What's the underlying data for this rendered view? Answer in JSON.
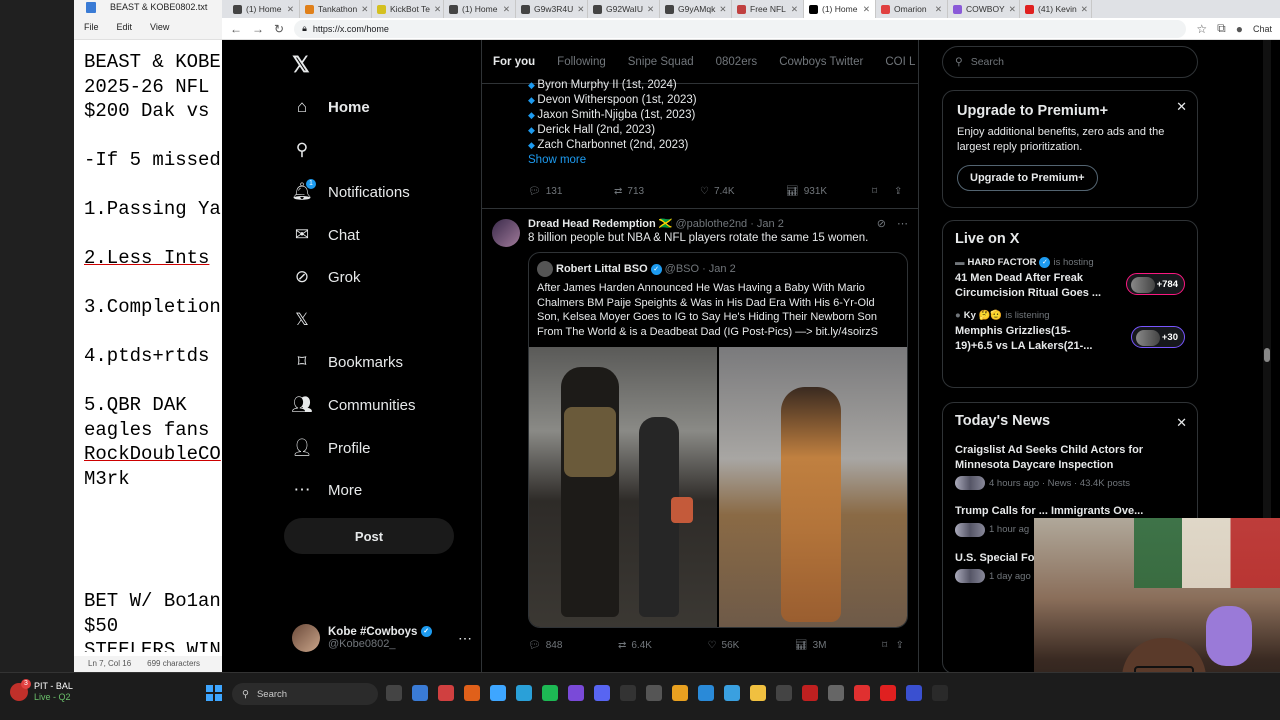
{
  "notepad": {
    "title": "BEAST & KOBE0802.txt",
    "menu": [
      "File",
      "Edit",
      "View"
    ],
    "lines": [
      "BEAST & KOBE",
      "2025-26 NFL",
      "$200 Dak vs",
      "",
      "-If 5 missed",
      "",
      "1.Passing Ya",
      "",
      "2.Less Ints",
      "",
      "3.Completion",
      "",
      "4.ptds+rtds",
      "",
      "5.QBR DAK",
      "eagles fans",
      "RockDoubleCO",
      "M3rk",
      "",
      "",
      "",
      "",
      "BET W/ Bo1an",
      "$50",
      "STEELERS WIN"
    ],
    "status_position": "Ln 7, Col 16",
    "status_chars": "699 characters"
  },
  "browser": {
    "tabs": [
      {
        "label": "(1) Home",
        "color": "#444"
      },
      {
        "label": "Tankathon",
        "color": "#e0801a"
      },
      {
        "label": "KickBot Te",
        "color": "#d4c020"
      },
      {
        "label": "(1) Home",
        "color": "#444"
      },
      {
        "label": "G9w3R4U",
        "color": "#444"
      },
      {
        "label": "G92WaIU",
        "color": "#444"
      },
      {
        "label": "G9yAMqk",
        "color": "#444"
      },
      {
        "label": "Free NFL",
        "color": "#c04040"
      },
      {
        "label": "(1) Home",
        "color": "#000"
      },
      {
        "label": "Omarion",
        "color": "#e04040"
      },
      {
        "label": "COWBOY",
        "color": "#8a5ad8"
      },
      {
        "label": "(41) Kevin",
        "color": "#e02020"
      }
    ],
    "url": "https://x.com/home",
    "chat_label": "Chat"
  },
  "nav": {
    "items": [
      {
        "label": "Home",
        "icon": "home-icon",
        "glyph": "⌂"
      },
      {
        "label": "",
        "icon": "search-icon",
        "glyph": "⚲"
      },
      {
        "label": "Notifications",
        "icon": "bell-icon",
        "glyph": "🔔︎"
      },
      {
        "label": "Chat",
        "icon": "mail-icon",
        "glyph": "✉"
      },
      {
        "label": "Grok",
        "icon": "grok-icon",
        "glyph": "⊘"
      },
      {
        "label": "",
        "icon": "x-icon",
        "glyph": "𝕏"
      },
      {
        "label": "Bookmarks",
        "icon": "bookmark-icon",
        "glyph": "⌑"
      },
      {
        "label": "Communities",
        "icon": "communities-icon",
        "glyph": "👥︎"
      },
      {
        "label": "Profile",
        "icon": "profile-icon",
        "glyph": "👤︎"
      },
      {
        "label": "More",
        "icon": "more-icon",
        "glyph": "⋯"
      }
    ],
    "notif_badge": "1",
    "post_label": "Post",
    "account_name": "Kobe #Cowboys",
    "account_handle": "@Kobe0802_"
  },
  "feed": {
    "tabs": [
      "For you",
      "Following",
      "Snipe Squad",
      "0802ers",
      "Cowboys Twitter",
      "COI L"
    ],
    "list": [
      "Byron Murphy II (1st, 2024)",
      "Devon Witherspoon (1st, 2023)",
      "Jaxon Smith-Njigba (1st, 2023)",
      "Derick Hall (2nd, 2023)",
      "Zach Charbonnet (2nd, 2023)"
    ],
    "show_more": "Show more",
    "stats1": {
      "replies": "131",
      "reposts": "713",
      "likes": "7.4K",
      "views": "931K"
    },
    "tweet": {
      "name": "Dread Head Redemption",
      "flag": "🇯🇲",
      "handle": "@pablothe2nd",
      "time": "· Jan 2",
      "text": "8 billion people but NBA & NFL players rotate the same 15 women.",
      "quote_name": "Robert Littal BSO",
      "quote_handle": "@BSO",
      "quote_time": "· Jan 2",
      "quote_text": "After James Harden Announced He Was Having a Baby With Mario Chalmers BM Paije Speights & Was in His Dad Era With His 6-Yr-Old Son, Kelsea Moyer Goes to IG to Say He's Hiding Their Newborn Son From The World & is a Deadbeat Dad (IG Post-Pics) —> bit.ly/4soirzS",
      "stats": {
        "replies": "848",
        "reposts": "6.4K",
        "likes": "56K",
        "views": "3M"
      }
    }
  },
  "right": {
    "search_placeholder": "Search",
    "premium": {
      "title": "Upgrade to Premium+",
      "text": "Enjoy additional benefits, zero ads and the largest reply prioritization.",
      "button": "Upgrade to Premium+"
    },
    "live": {
      "title": "Live on X",
      "items": [
        {
          "host": "HARD FACTOR",
          "status": "is hosting",
          "title": "41 Men Dead After Freak Circumcision Ritual Goes ...",
          "count": "+784"
        },
        {
          "host": "Ky 🤔🫡",
          "status": "is listening",
          "title": "Memphis Grizzlies(15-19)+6.5 vs LA Lakers(21-...",
          "count": "+30"
        }
      ]
    },
    "news": {
      "title": "Today's News",
      "items": [
        {
          "title": "Craigslist Ad Seeks Child Actors for Minnesota Daycare Inspection",
          "meta": "4 hours ago · News · 43.4K posts"
        },
        {
          "title": "Trump Calls for ... Immigrants Ove...",
          "meta": "1 hour ag"
        },
        {
          "title": "U.S. Special For... Caracas Raid",
          "meta": "1 day ago"
        }
      ]
    }
  },
  "taskbar": {
    "game_teams": "PIT - BAL",
    "game_status": "Live - Q2",
    "game_badge": "3",
    "search": "Search"
  }
}
